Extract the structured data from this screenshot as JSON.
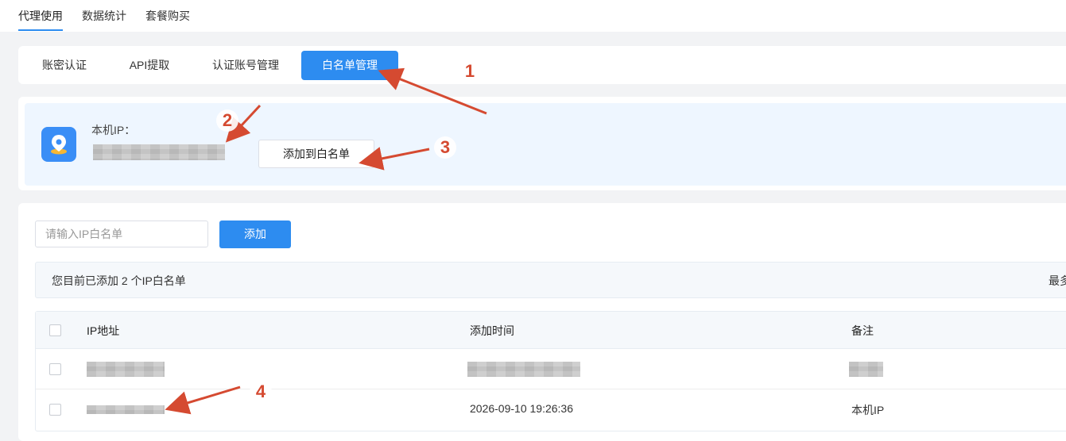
{
  "top_nav": {
    "tabs": [
      "代理使用",
      "数据统计",
      "套餐购买"
    ],
    "active_index": 0
  },
  "sub_tabs": {
    "tabs": [
      "账密认证",
      "API提取",
      "认证账号管理",
      "白名单管理"
    ],
    "active_index": 3
  },
  "local_ip": {
    "label": "本机IP：",
    "icon": "location-pin-icon",
    "add_button": "添加到白名单"
  },
  "add_form": {
    "placeholder": "请输入IP白名单",
    "add_button": "添加"
  },
  "notice": {
    "text": "您目前已添加 2 个IP白名单",
    "right_text": "最多"
  },
  "table": {
    "columns": [
      "IP地址",
      "添加时间",
      "备注"
    ],
    "rows": [
      {
        "ip": "",
        "time": "",
        "remark": ""
      },
      {
        "ip": "",
        "time": "2026-09-10 19:26:36",
        "remark": "本机IP"
      }
    ]
  },
  "annotations": [
    "1",
    "2",
    "3",
    "4"
  ],
  "colors": {
    "accent": "#2d8cf0",
    "annotation": "#d54a31"
  }
}
